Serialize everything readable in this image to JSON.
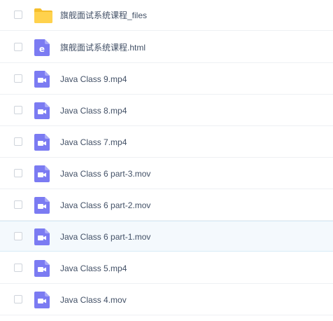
{
  "files": [
    {
      "name": "旗舰面试系统课程_files",
      "icon": "folder-icon",
      "highlighted": false
    },
    {
      "name": "旗舰面试系统课程.html",
      "icon": "html-file-icon",
      "highlighted": false
    },
    {
      "name": "Java Class 9.mp4",
      "icon": "video-file-icon",
      "highlighted": false
    },
    {
      "name": "Java Class 8.mp4",
      "icon": "video-file-icon",
      "highlighted": false
    },
    {
      "name": "Java Class 7.mp4",
      "icon": "video-file-icon",
      "highlighted": false
    },
    {
      "name": "Java Class 6 part-3.mov",
      "icon": "video-file-icon",
      "highlighted": false
    },
    {
      "name": "Java Class 6 part-2.mov",
      "icon": "video-file-icon",
      "highlighted": false
    },
    {
      "name": "Java Class 6 part-1.mov",
      "icon": "video-file-icon",
      "highlighted": true
    },
    {
      "name": "Java Class 5.mp4",
      "icon": "video-file-icon",
      "highlighted": false
    },
    {
      "name": "Java Class 4.mov",
      "icon": "video-file-icon",
      "highlighted": false
    }
  ],
  "colors": {
    "folder": "#ffd24d",
    "folder_dark": "#f5be2c",
    "file_icon": "#7b7bf2",
    "file_icon_fold": "#a9a9f7",
    "text": "#425066",
    "highlight_bg": "#f4f9fd"
  }
}
